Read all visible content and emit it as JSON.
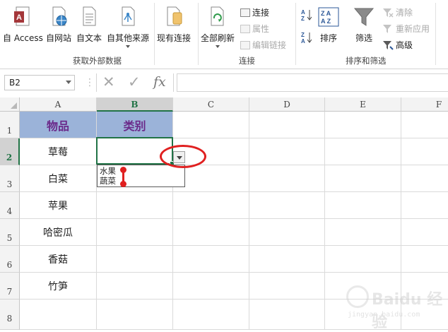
{
  "ribbon": {
    "access_label": "自 Access",
    "web_label": "自网站",
    "text_label": "自文本",
    "other_label": "自其他来源",
    "existing_label": "现有连接",
    "refresh_label": "全部刷新",
    "connect_label": "连接",
    "props_label": "属性",
    "editlinks_label": "编辑链接",
    "sort_label": "排序",
    "filter_label": "筛选",
    "clear_label": "清除",
    "reapply_label": "重新应用",
    "advanced_label": "高级",
    "group_external": "获取外部数据",
    "group_connections": "连接",
    "group_sortfilter": "排序和筛选"
  },
  "formula": {
    "namebox": "B2",
    "fx_label": "fx",
    "cancel_glyph": "✕",
    "enter_glyph": "✓",
    "formula_value": ""
  },
  "columns": [
    "A",
    "B",
    "C",
    "D",
    "E",
    "F"
  ],
  "rows": [
    "1",
    "2",
    "3",
    "4",
    "5",
    "6",
    "7",
    "8"
  ],
  "header": {
    "a1": "物品",
    "b1": "类别"
  },
  "items": [
    "草莓",
    "白菜",
    "苹果",
    "哈密瓜",
    "香菇",
    "竹笋"
  ],
  "dropdown": {
    "options": [
      "水果",
      "蔬菜"
    ]
  },
  "watermark": {
    "logo": "Baidu 经验",
    "url": "jingyan.baidu.com"
  },
  "colors": {
    "selection": "#217346",
    "header_fill": "#9bb3d9",
    "header_text": "#6b2a8a",
    "annotation": "#e02020"
  }
}
